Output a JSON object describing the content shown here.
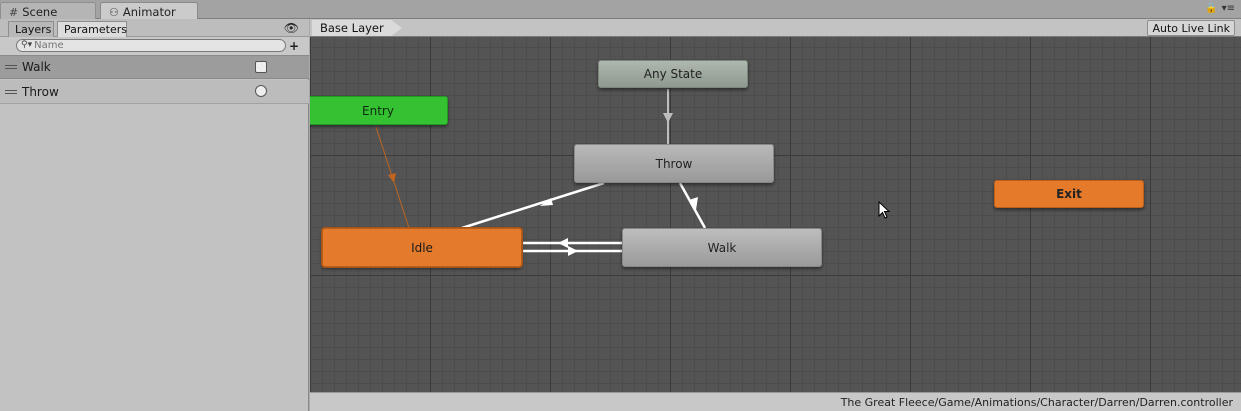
{
  "tabs": {
    "scene": "Scene",
    "animator": "Animator"
  },
  "left_panel": {
    "tabs": [
      "Layers",
      "Parameters"
    ],
    "search_placeholder": "Name",
    "parameters": [
      {
        "name": "Walk",
        "type": "bool",
        "value": false
      },
      {
        "name": "Throw",
        "type": "trigger",
        "value": false
      }
    ]
  },
  "graph": {
    "breadcrumb": "Base Layer",
    "auto_live_link": "Auto Live Link",
    "states": {
      "any_state": "Any State",
      "entry": "Entry",
      "throw": "Throw",
      "exit": "Exit",
      "idle": "Idle",
      "walk": "Walk"
    },
    "colors": {
      "entry": "#34c232",
      "default_state": "#e47b2c",
      "exit": "#e57a2a",
      "state": "#a8a8a8",
      "any_state": "#9faa9f",
      "background": "#545454"
    }
  },
  "footer": {
    "path": "The Great Fleece/Game/Animations/Character/Darren/Darren.controller"
  }
}
